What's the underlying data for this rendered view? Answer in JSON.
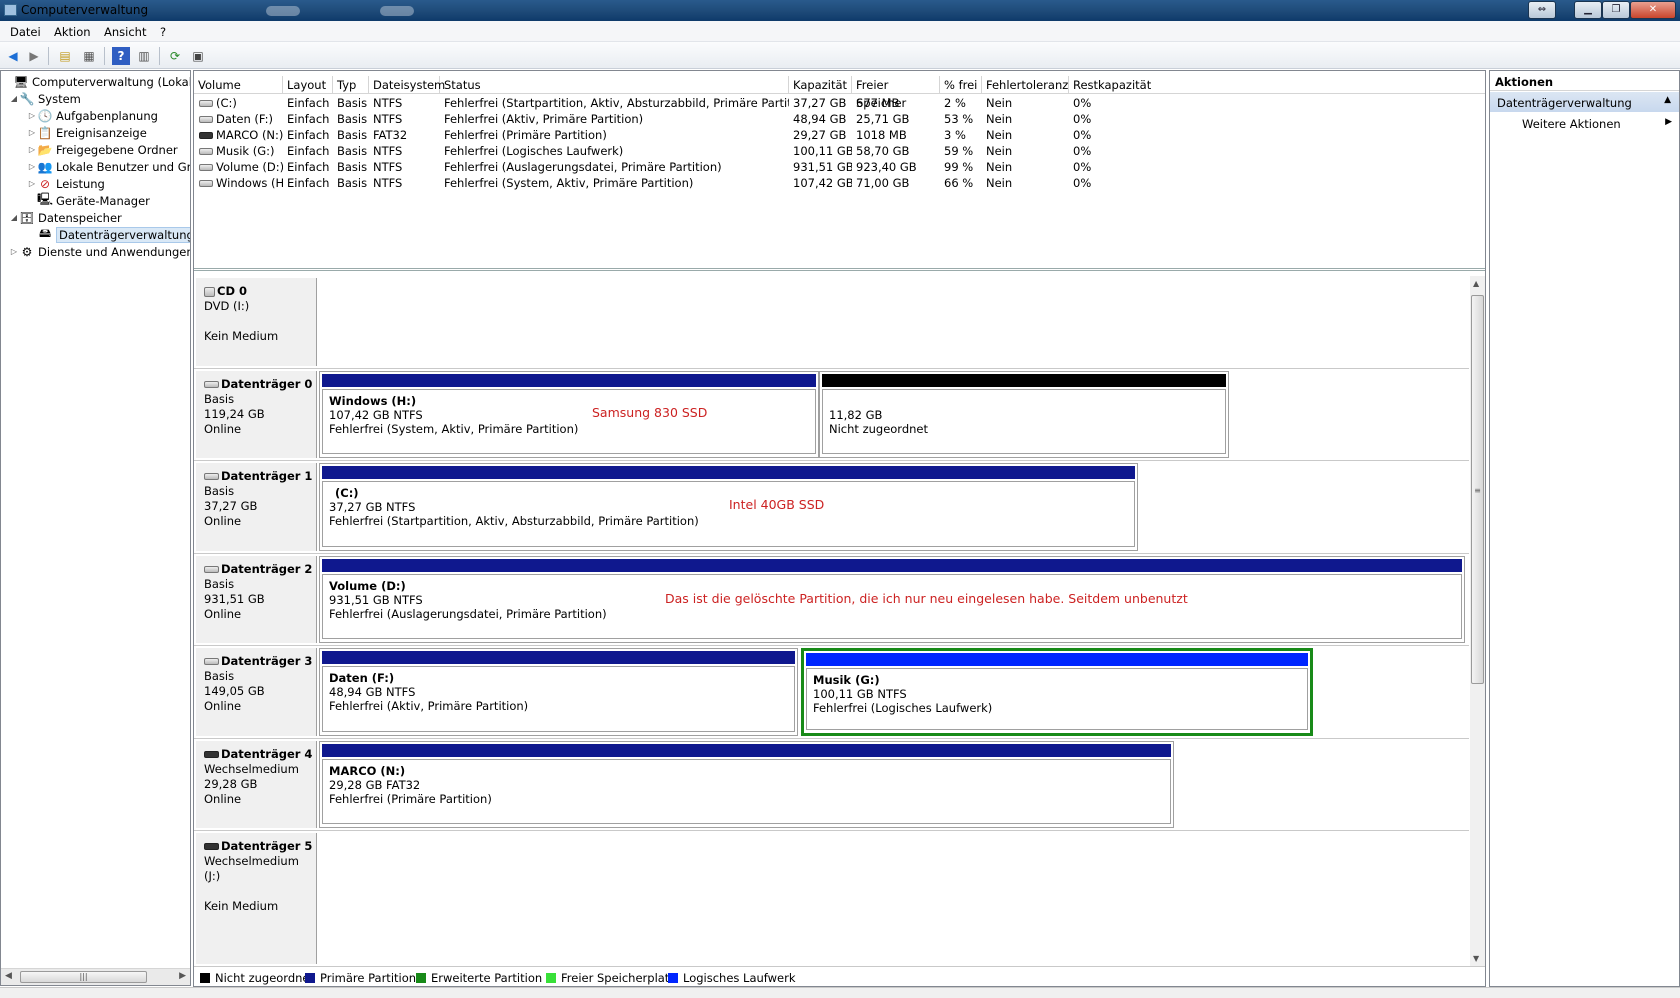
{
  "window": {
    "title": "Computerverwaltung"
  },
  "menu": [
    "Datei",
    "Aktion",
    "Ansicht",
    "?"
  ],
  "toolbar": {
    "icons": [
      "back-icon",
      "forward-icon",
      "up-folder-icon",
      "show-tree-icon",
      "help-icon",
      "show-pane-icon",
      "refresh-icon",
      "properties-icon"
    ]
  },
  "tree": {
    "root": "Computerverwaltung (Lokal)",
    "system": "System",
    "aufgaben": "Aufgabenplanung",
    "ereignis": "Ereignisanzeige",
    "freigabe": "Freigegebene Ordner",
    "lokal": "Lokale Benutzer und Gruppen",
    "leistung": "Leistung",
    "geraete": "Geräte-Manager",
    "datenspeicher": "Datenspeicher",
    "dtv": "Datenträgerverwaltung",
    "dienste": "Dienste und Anwendungen"
  },
  "volume_table": {
    "headers": [
      "Volume",
      "Layout",
      "Typ",
      "Dateisystem",
      "Status",
      "Kapazität",
      "Freier Speicher",
      "% frei",
      "Fehlertoleranz",
      "Restkapazität"
    ],
    "rows": [
      [
        "(C:)",
        "Einfach",
        "Basis",
        "NTFS",
        "Fehlerfrei (Startpartition, Aktiv, Absturzabbild, Primäre Partition)",
        "37,27 GB",
        "677 MB",
        "2 %",
        "Nein",
        "0%"
      ],
      [
        "Daten (F:)",
        "Einfach",
        "Basis",
        "NTFS",
        "Fehlerfrei (Aktiv, Primäre Partition)",
        "48,94 GB",
        "25,71 GB",
        "53 %",
        "Nein",
        "0%"
      ],
      [
        "MARCO (N:)",
        "Einfach",
        "Basis",
        "FAT32",
        "Fehlerfrei (Primäre Partition)",
        "29,27 GB",
        "1018 MB",
        "3 %",
        "Nein",
        "0%"
      ],
      [
        "Musik (G:)",
        "Einfach",
        "Basis",
        "NTFS",
        "Fehlerfrei (Logisches Laufwerk)",
        "100,11 GB",
        "58,70 GB",
        "59 %",
        "Nein",
        "0%"
      ],
      [
        "Volume (D:)",
        "Einfach",
        "Basis",
        "NTFS",
        "Fehlerfrei (Auslagerungsdatei, Primäre Partition)",
        "931,51 GB",
        "923,40 GB",
        "99 %",
        "Nein",
        "0%"
      ],
      [
        "Windows (H:)",
        "Einfach",
        "Basis",
        "NTFS",
        "Fehlerfrei (System, Aktiv, Primäre Partition)",
        "107,42 GB",
        "71,00 GB",
        "66 %",
        "Nein",
        "0%"
      ]
    ]
  },
  "disks": {
    "cd0": {
      "name": "CD 0",
      "l1": "DVD (I:)",
      "l3": "Kein Medium"
    },
    "d0": {
      "name": "Datenträger 0",
      "type": "Basis",
      "size": "119,24 GB",
      "state": "Online",
      "p1": {
        "title": "Windows  (H:)",
        "size": "107,42 GB NTFS",
        "status": "Fehlerfrei (System, Aktiv, Primäre Partition)"
      },
      "p2": {
        "size": "11,82 GB",
        "status": "Nicht zugeordnet"
      },
      "annotation": "Samsung 830 SSD"
    },
    "d1": {
      "name": "Datenträger 1",
      "type": "Basis",
      "size": "37,27 GB",
      "state": "Online",
      "p1": {
        "title": "(C:)",
        "size": "37,27 GB NTFS",
        "status": "Fehlerfrei (Startpartition, Aktiv, Absturzabbild, Primäre Partition)"
      },
      "annotation": "Intel 40GB SSD"
    },
    "d2": {
      "name": "Datenträger 2",
      "type": "Basis",
      "size": "931,51 GB",
      "state": "Online",
      "p1": {
        "title": "Volume  (D:)",
        "size": "931,51 GB NTFS",
        "status": "Fehlerfrei (Auslagerungsdatei, Primäre Partition)"
      },
      "annotation": "Das ist die gelöschte Partition, die ich nur neu eingelesen habe. Seitdem unbenutzt"
    },
    "d3": {
      "name": "Datenträger 3",
      "type": "Basis",
      "size": "149,05 GB",
      "state": "Online",
      "p1": {
        "title": "Daten  (F:)",
        "size": "48,94 GB NTFS",
        "status": "Fehlerfrei (Aktiv, Primäre Partition)"
      },
      "p2": {
        "title": "Musik  (G:)",
        "size": "100,11 GB NTFS",
        "status": "Fehlerfrei (Logisches Laufwerk)"
      }
    },
    "d4": {
      "name": "Datenträger 4",
      "type": "Wechselmedium",
      "size": "29,28 GB",
      "state": "Online",
      "p1": {
        "title": "MARCO  (N:)",
        "size": "29,28 GB FAT32",
        "status": "Fehlerfrei (Primäre Partition)"
      }
    },
    "d5": {
      "name": "Datenträger 5",
      "l1": "Wechselmedium (J:)",
      "l3": "Kein Medium"
    }
  },
  "legend": [
    {
      "label": "Nicht zugeordnet",
      "color": "#000000"
    },
    {
      "label": "Primäre Partition",
      "color": "#0f188e"
    },
    {
      "label": "Erweiterte Partition",
      "color": "#188a18"
    },
    {
      "label": "Freier Speicherplatz",
      "color": "#38e038"
    },
    {
      "label": "Logisches Laufwerk",
      "color": "#0026ff"
    }
  ],
  "actions": {
    "header": "Aktionen",
    "section": "Datenträgerverwaltung",
    "more": "Weitere Aktionen"
  }
}
